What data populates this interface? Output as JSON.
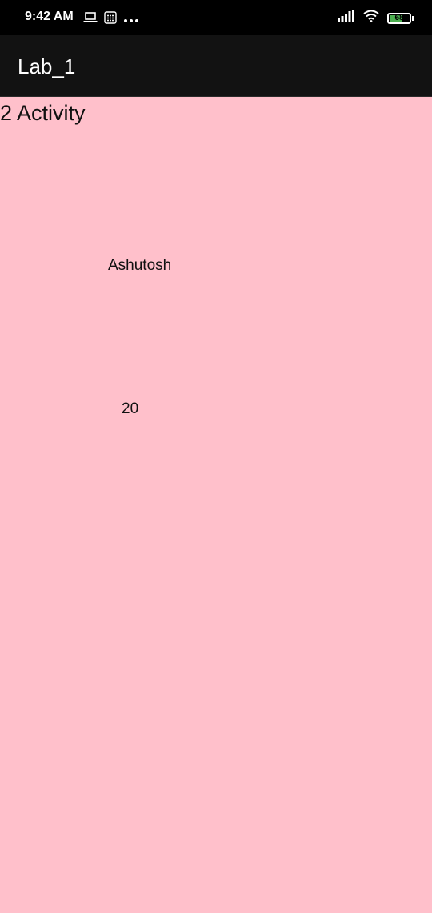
{
  "status_bar": {
    "time": "9:42 AM",
    "battery_level": "68",
    "icons": [
      "laptop-icon",
      "sim-icon",
      "more-dots-icon",
      "signal-icon",
      "wifi-icon",
      "battery-icon"
    ]
  },
  "app_bar": {
    "title": "Lab_1"
  },
  "main": {
    "heading": "2 Activity",
    "name_value": "Ashutosh",
    "age_value": "20"
  },
  "colors": {
    "background": "#ffc0cb",
    "app_bar": "#121212",
    "status_bar": "#000000",
    "battery_fill": "#4caf50"
  }
}
